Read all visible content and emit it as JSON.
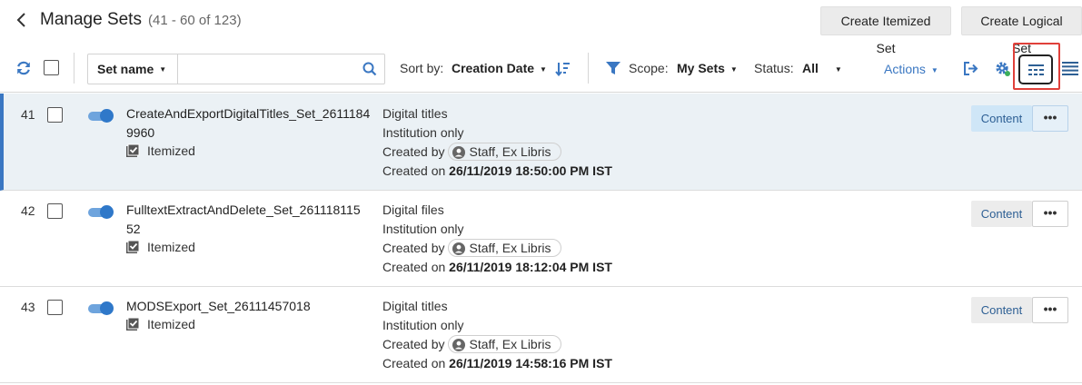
{
  "header": {
    "title": "Manage Sets",
    "range": "(41 - 60 of 123)",
    "create_itemized_label": "Create Itemized Set",
    "create_logical_label": "Create Logical Set"
  },
  "toolbar": {
    "search_field": "Set name",
    "search_value": "",
    "sort_label": "Sort by:",
    "sort_value": "Creation Date",
    "scope_label": "Scope:",
    "scope_value": "My Sets",
    "status_label": "Status:",
    "status_value": "All",
    "actions_label": "Actions",
    "icons": [
      "refresh-icon",
      "search-icon",
      "sort-direction-icon",
      "filter-icon",
      "export-icon",
      "settings-icon",
      "compact-layout-icon",
      "list-layout-icon"
    ]
  },
  "colors": {
    "accent": "#3a77c2",
    "highlight": "#e0403a",
    "active_row": "#ebf1f5"
  },
  "rows": [
    {
      "num": "41",
      "name": "CreateAndExportDigitalTitles_Set_26111849960",
      "type": "Itemized",
      "content_type": "Digital titles",
      "visibility": "Institution only",
      "created_by_label": "Created by",
      "creator": "Staff, Ex Libris",
      "created_on_label": "Created on",
      "created_on": "26/11/2019 18:50:00 PM IST",
      "content_label": "Content",
      "more_label": "•••",
      "active": true
    },
    {
      "num": "42",
      "name": "FulltextExtractAndDelete_Set_26111811552",
      "type": "Itemized",
      "content_type": "Digital files",
      "visibility": "Institution only",
      "created_by_label": "Created by",
      "creator": "Staff, Ex Libris",
      "created_on_label": "Created on",
      "created_on": "26/11/2019 18:12:04 PM IST",
      "content_label": "Content",
      "more_label": "•••",
      "active": false
    },
    {
      "num": "43",
      "name": "MODSExport_Set_26111457018",
      "type": "Itemized",
      "content_type": "Digital titles",
      "visibility": "Institution only",
      "created_by_label": "Created by",
      "creator": "Staff, Ex Libris",
      "created_on_label": "Created on",
      "created_on": "26/11/2019 14:58:16 PM IST",
      "content_label": "Content",
      "more_label": "•••",
      "active": false
    }
  ]
}
